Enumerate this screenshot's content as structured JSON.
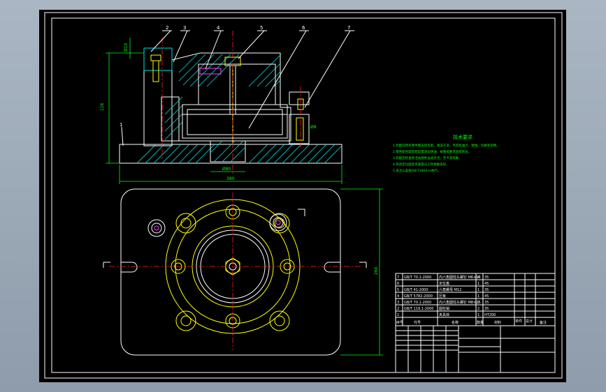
{
  "drawing": {
    "part_callouts": [
      "1",
      "2",
      "3",
      "4",
      "5",
      "6",
      "7"
    ],
    "tech_requirements_title": "技术要求",
    "tech_requirements_lines": [
      "1.装配前所有零件需去除毛刺，清洗干净，不得有油污、锈蚀、切屑等杂物。",
      "2.零件配合面装配前需涂润滑油，按图纸要求装配到位。",
      "3.装配后检查各活动部件运动灵活，无卡滞现象。",
      "4.夹具定位面及夹紧面与工件接触良好。",
      "5.未注公差按GB/T1804-m执行。"
    ]
  },
  "title_block": {
    "bom_rows": [
      {
        "no": "7",
        "code": "GB/T 70.1-2000",
        "name": "内六角圆柱头螺钉 M6×16",
        "qty": "4",
        "material": "35",
        "note": ""
      },
      {
        "no": "6",
        "code": "",
        "name": "定位盘",
        "qty": "1",
        "material": "45",
        "note": ""
      },
      {
        "no": "5",
        "code": "GB/T 41-2000",
        "name": "六角螺母 M12",
        "qty": "1",
        "material": "35",
        "note": ""
      },
      {
        "no": "4",
        "code": "GB/T 5782-2000",
        "name": "压板",
        "qty": "1",
        "material": "45",
        "note": ""
      },
      {
        "no": "3",
        "code": "GB/T 70.1-2000",
        "name": "内六角圆柱头螺钉 M8×25",
        "qty": "2",
        "material": "35",
        "note": ""
      },
      {
        "no": "2",
        "code": "GB/T 119.1-2000",
        "name": "圆柱销",
        "qty": "2",
        "material": "35",
        "note": ""
      },
      {
        "no": "1",
        "code": "",
        "name": "夹具体",
        "qty": "1",
        "material": "HT200",
        "note": ""
      }
    ],
    "headers": {
      "no": "序号",
      "code": "代号",
      "name": "名称",
      "qty": "数量",
      "material": "材料",
      "single": "单件",
      "total": "总计",
      "weight": "重量",
      "note": "备注"
    }
  }
}
